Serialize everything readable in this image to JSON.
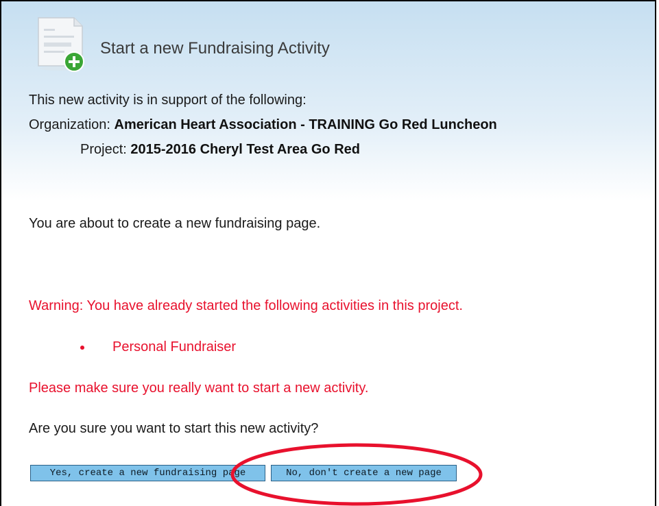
{
  "header": {
    "title": "Start a new Fundraising Activity",
    "icon": "document-add-icon"
  },
  "support": {
    "intro": "This new activity is in support of the following:",
    "organization_label": "Organization:",
    "organization_value": "American Heart Association - TRAINING Go Red Luncheon",
    "project_label": "Project:",
    "project_value": "2015-2016 Cheryl Test Area Go Red"
  },
  "main": {
    "about_text": "You are about to create a new fundraising page.",
    "warning_text": "Warning: You have already started the following activities in this project.",
    "activities": [
      {
        "label": "Personal Fundraiser"
      }
    ],
    "sure_warning": "Please make sure you really want to start a new activity.",
    "confirm_question": "Are you sure you want to start this new activity?"
  },
  "buttons": {
    "yes_label": "Yes, create a new fundraising page",
    "no_label": "No, don't create a new page"
  },
  "colors": {
    "warning": "#e8112d",
    "button_bg": "#7fc2ea",
    "header_gradient_top": "#c6dff1",
    "annotation": "#e8112d",
    "plus_badge": "#3aa635"
  }
}
